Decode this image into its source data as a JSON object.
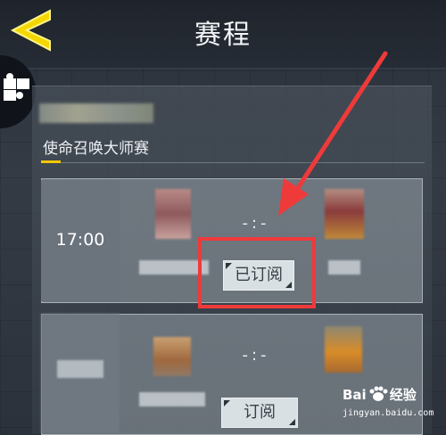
{
  "header": {
    "title": "赛程"
  },
  "section": {
    "label": "使命召唤大师赛"
  },
  "matches": [
    {
      "time": "17:00",
      "score": "-:-",
      "subscribe_label": "已订阅"
    },
    {
      "time": "",
      "score": "-:-",
      "subscribe_label": "订阅"
    }
  ],
  "watermark": {
    "brand": "Bai",
    "brand_suffix": "经验",
    "url": "jingyan.baidu.com"
  },
  "colors": {
    "accent": "#f2c700",
    "highlight": "#ef3a3a"
  },
  "icons": {
    "back": "back-chevron-icon",
    "side": "puzzle-icon"
  }
}
